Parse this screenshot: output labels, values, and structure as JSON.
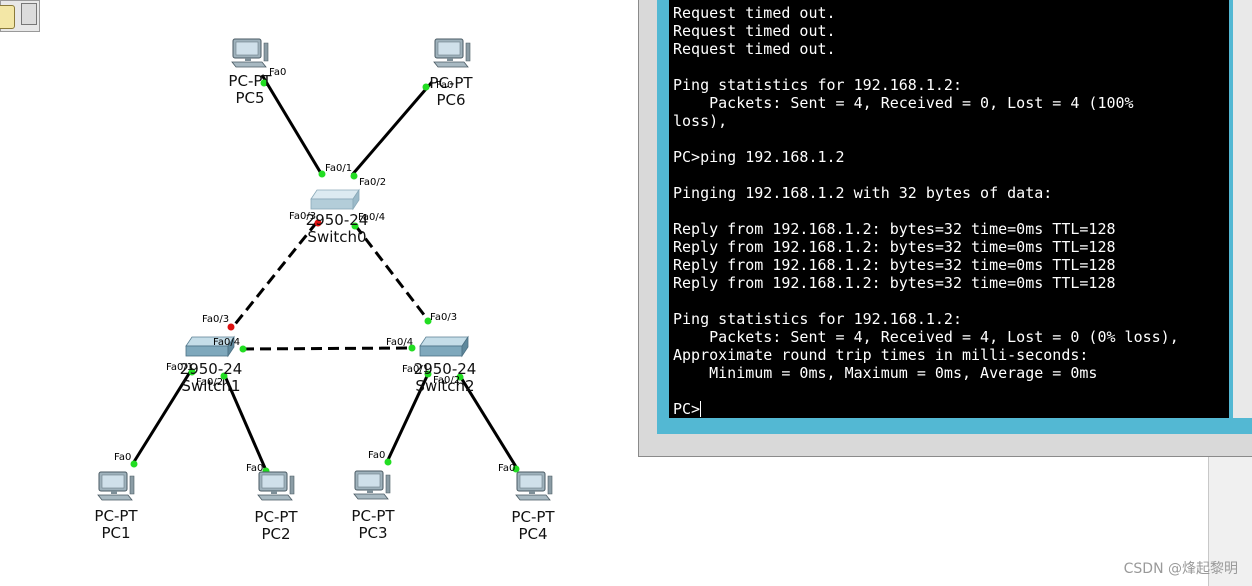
{
  "topology": {
    "devices": [
      {
        "id": "pc5",
        "type": "pc",
        "model": "PC-PT",
        "name": "PC5"
      },
      {
        "id": "pc6",
        "type": "pc",
        "model": "PC-PT",
        "name": "PC6"
      },
      {
        "id": "switch0",
        "type": "switch",
        "model": "2950-24",
        "name": "Switch0"
      },
      {
        "id": "switch1",
        "type": "switch",
        "model": "2950-24",
        "name": "Switch1"
      },
      {
        "id": "switch2",
        "type": "switch",
        "model": "2950-24",
        "name": "Switch2"
      },
      {
        "id": "pc1",
        "type": "pc",
        "model": "PC-PT",
        "name": "PC1"
      },
      {
        "id": "pc2",
        "type": "pc",
        "model": "PC-PT",
        "name": "PC2"
      },
      {
        "id": "pc3",
        "type": "pc",
        "model": "PC-PT",
        "name": "PC3"
      },
      {
        "id": "pc4",
        "type": "pc",
        "model": "PC-PT",
        "name": "PC4"
      }
    ],
    "ports": {
      "pc5_fa0": "Fa0",
      "pc6_fa0": "Fa0",
      "sw0_fa01": "Fa0/1",
      "sw0_fa02": "Fa0/2",
      "sw0_fa03": "Fa0/3",
      "sw0_fa04": "Fa0/4",
      "sw1_fa03": "Fa0/3",
      "sw1_fa04": "Fa0/4",
      "sw1_fa01": "Fa0/1",
      "sw1_fa02": "Fa0/2",
      "sw2_fa03": "Fa0/3",
      "sw2_fa04": "Fa0/4",
      "sw2_fa01": "Fa0/1",
      "sw2_fa02": "Fa0/2",
      "pc1_fa0": "Fa0",
      "pc2_fa0": "Fa0",
      "pc3_fa0": "Fa0",
      "pc4_fa0": "Fa0"
    },
    "links": [
      {
        "name": "link-pc5-switch0",
        "cable": "straight",
        "end_a": "up",
        "end_b": "up"
      },
      {
        "name": "link-pc6-switch0",
        "cable": "straight",
        "end_a": "up",
        "end_b": "up"
      },
      {
        "name": "link-switch0-switch1",
        "cable": "crossover",
        "end_a": "blocked",
        "end_b": "blocked"
      },
      {
        "name": "link-switch0-switch2",
        "cable": "crossover",
        "end_a": "up",
        "end_b": "up"
      },
      {
        "name": "link-switch1-switch2",
        "cable": "crossover",
        "end_a": "up",
        "end_b": "up"
      },
      {
        "name": "link-switch1-pc1",
        "cable": "straight",
        "end_a": "up",
        "end_b": "up"
      },
      {
        "name": "link-switch1-pc2",
        "cable": "straight",
        "end_a": "up",
        "end_b": "up"
      },
      {
        "name": "link-switch2-pc3",
        "cable": "straight",
        "end_a": "up",
        "end_b": "up"
      },
      {
        "name": "link-switch2-pc4",
        "cable": "straight",
        "end_a": "up",
        "end_b": "up"
      }
    ],
    "status_colors": {
      "up": "#22dd22",
      "blocked": "#dd1111"
    }
  },
  "terminal": {
    "lines": [
      "Request timed out.",
      "Request timed out.",
      "Request timed out.",
      "",
      "Ping statistics for 192.168.1.2:",
      "    Packets: Sent = 4, Received = 0, Lost = 4 (100%",
      "loss),",
      "",
      "PC>ping 192.168.1.2",
      "",
      "Pinging 192.168.1.2 with 32 bytes of data:",
      "",
      "Reply from 192.168.1.2: bytes=32 time=0ms TTL=128",
      "Reply from 192.168.1.2: bytes=32 time=0ms TTL=128",
      "Reply from 192.168.1.2: bytes=32 time=0ms TTL=128",
      "Reply from 192.168.1.2: bytes=32 time=0ms TTL=128",
      "",
      "Ping statistics for 192.168.1.2:",
      "    Packets: Sent = 4, Received = 4, Lost = 0 (0% loss),",
      "Approximate round trip times in milli-seconds:",
      "    Minimum = 0ms, Maximum = 0ms, Average = 0ms"
    ],
    "prompt": "PC>",
    "frame_color": "#53b8d3"
  },
  "watermark": "CSDN @烽起黎明"
}
